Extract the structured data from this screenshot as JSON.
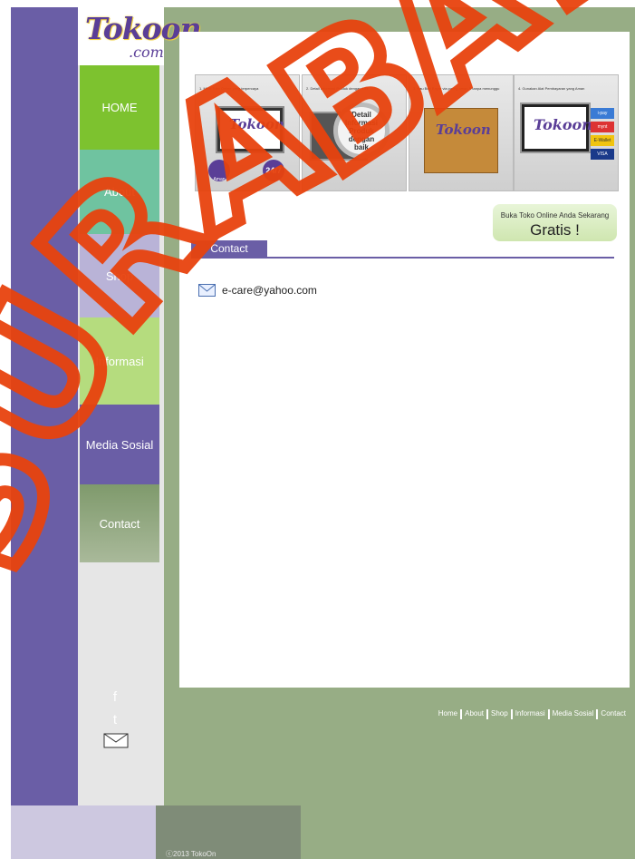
{
  "logo": {
    "main": "Tokoon",
    "sub": ".com"
  },
  "nav": [
    {
      "label": "HOME",
      "color": "#7dc22f"
    },
    {
      "label": "About",
      "color": "#6fc3a0"
    },
    {
      "label": "Shop",
      "color": "#b9b3d7"
    },
    {
      "label": "Informasi",
      "color": "#b5dc7e"
    },
    {
      "label": "Media Sosial",
      "color": "#6a5ea6"
    },
    {
      "label": "Contact",
      "color": "#8ea27d"
    }
  ],
  "banners": [
    {
      "caption": "1. Miliki Toko Online yang terpercaya",
      "badge1": "Aman",
      "badge2": "24/7",
      "logo": "Tokoon"
    },
    {
      "caption": "2. Detail Informasi Produk dengan baik",
      "lens": "Detail Informasi Produk dengan baik"
    },
    {
      "caption": "3. Kau Beri Bayar via paling aman & tanpa menunggu",
      "logo": "Tokoon"
    },
    {
      "caption": "4. Gunakan Alat Pembayaran yang Aman",
      "logo": "Tokoon",
      "pay": [
        "i-pay",
        "mynt",
        "E-Wallet",
        "VISA"
      ]
    }
  ],
  "cta": {
    "line1": "Buka Toko Online Anda Sekarang",
    "line2": "Gratis !"
  },
  "contact": {
    "tab": "Contact",
    "email": "e-care@yahoo.com"
  },
  "social": {
    "facebook": "f",
    "twitter": "t"
  },
  "footer_links": [
    "Home",
    "About",
    "Shop",
    "Informasi",
    "Media Sosial",
    "Contact"
  ],
  "copyright": "ⓒ2013 TokoOn",
  "watermark": "SURABAYA"
}
